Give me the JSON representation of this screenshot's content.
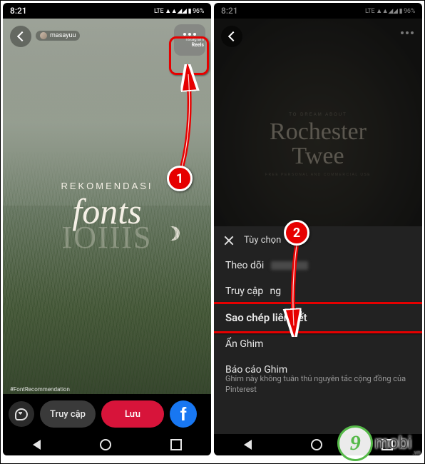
{
  "status": {
    "time": "8:21",
    "right": "LTE ▲▲◢◢ ▮ 96%"
  },
  "left": {
    "username": "masayuu",
    "more_label_top": "nstagram",
    "more_label_bottom": "Reels",
    "title_small": "REKOMENDASI",
    "title_big": "fonts",
    "title_shadow": "IOIIIS",
    "hashtag": "#FontRecommendation",
    "visit": "Truy cập",
    "save": "Lưu"
  },
  "right": {
    "bg_tiny": "TO DREAM ABOUT",
    "bg_big1": "Rochester",
    "bg_big2": "Twee",
    "bg_tiny2": "FREE PERSONAL AND COMMERCIAL USE",
    "sheet_title": "Tùy chọn",
    "items": {
      "follow": "Theo dõi",
      "visit": "Truy cập",
      "visit_suffix": "ng",
      "copy": "Sao chép liên kết",
      "hide": "Ẩn Ghim",
      "report": "Báo cáo Ghim",
      "report_sub": "Ghim này không tuân thủ nguyên tắc cộng đồng của Pinterest"
    }
  },
  "markers": {
    "m1": "1",
    "m2": "2"
  },
  "watermark": {
    "nine": "9",
    "text": "mobi",
    "suffix": ".vn"
  }
}
